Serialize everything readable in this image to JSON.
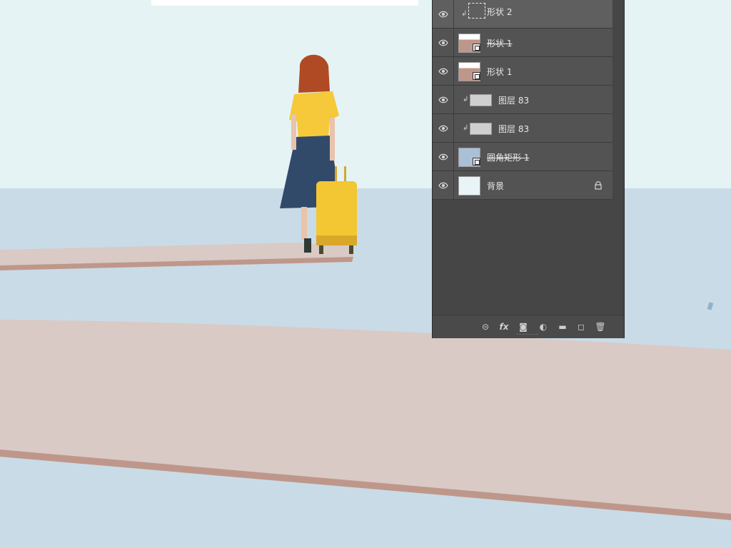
{
  "window": {
    "layers_panel": {
      "layers": [
        {
          "name": "形状 2",
          "visible": true,
          "kind": "shape",
          "clipped": true,
          "active": true,
          "strike": false
        },
        {
          "name": "形状 1",
          "visible": true,
          "kind": "shape",
          "clipped": false,
          "active": false,
          "strike": true
        },
        {
          "name": "形状 1",
          "visible": true,
          "kind": "shape",
          "clipped": false,
          "active": false,
          "strike": false
        },
        {
          "name": "图层 83",
          "visible": true,
          "kind": "pixel",
          "clipped": true,
          "active": false,
          "strike": false
        },
        {
          "name": "图层 83",
          "visible": true,
          "kind": "pixel",
          "clipped": true,
          "active": false,
          "strike": false
        },
        {
          "name": "圆角矩形 1",
          "visible": true,
          "kind": "shape",
          "clipped": false,
          "active": false,
          "strike": true
        },
        {
          "name": "背景",
          "visible": true,
          "kind": "background",
          "clipped": false,
          "active": false,
          "strike": false,
          "locked": true
        }
      ],
      "bottom_tools": [
        "link-icon",
        "fx-icon",
        "mask-icon",
        "adjustment-icon",
        "folder-icon",
        "new-layer-icon",
        "trash-icon"
      ],
      "fx_label": "fx"
    }
  },
  "canvas": {
    "sky_color": "#e5f3f4",
    "water_color": "#c9dbe7",
    "pier_color": "#d9cac5",
    "pier_edge_color": "#bf978a",
    "suitcase_color": "#f3c733",
    "shirt_color": "#f5c93a",
    "skirt_color": "#314a6a",
    "hair_color": "#b04a24"
  }
}
